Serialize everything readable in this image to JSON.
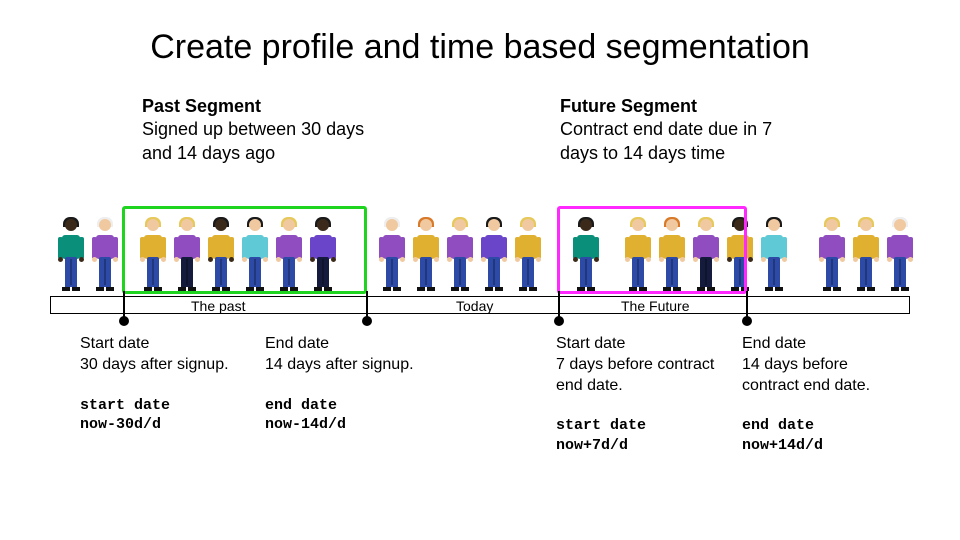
{
  "title": "Create profile and time based segmentation",
  "pastSegment": {
    "heading": "Past Segment",
    "desc": "Signed up between 30 days and 14 days ago"
  },
  "futureSegment": {
    "heading": "Future Segment",
    "desc": "Contract end date due in 7 days to 14 days time"
  },
  "timeline": {
    "past": "The past",
    "today": "Today",
    "future": "The Future"
  },
  "anno": {
    "pastStart": {
      "txt": "Start date\n30 days after signup.",
      "code": "start date\nnow-30d/d"
    },
    "pastEnd": {
      "txt": "End date\n14 days after signup.",
      "code": "end date\nnow-14d/d"
    },
    "futStart": {
      "txt": "Start date\n7 days before contract end date.",
      "code": "start date\nnow+7d/d"
    },
    "futEnd": {
      "txt": "End date\n14 days before contract end date.",
      "code": "end date\nnow+14d/d"
    }
  },
  "colors": {
    "pastBox": "#1fd41f",
    "futureBox": "#ff29ff",
    "pants": "#2d4aa6",
    "darkPants": "#141b3d"
  },
  "people": [
    {
      "skin": "#3b2a1a",
      "hair": "#1a1a1a",
      "shirt": "#0a8f7a",
      "pants": "#2d4aa6"
    },
    {
      "skin": "#f0c9a0",
      "hair": "#eee",
      "shirt": "#8f4dbf",
      "pants": "#2d4aa6"
    },
    {
      "skin": "#f0c9a0",
      "hair": "#e6c95a",
      "shirt": "#e0b030",
      "pants": "#2d4aa6"
    },
    {
      "skin": "#f0c9a0",
      "hair": "#e6c95a",
      "shirt": "#8f4dbf",
      "pants": "#141b3d"
    },
    {
      "skin": "#3b2a1a",
      "hair": "#1a1a1a",
      "shirt": "#e0b030",
      "pants": "#2d4aa6"
    },
    {
      "skin": "#f0c9a0",
      "hair": "#1a1a1a",
      "shirt": "#5fc9d6",
      "pants": "#2d4aa6"
    },
    {
      "skin": "#f0c9a0",
      "hair": "#e6c95a",
      "shirt": "#8f4dbf",
      "pants": "#2d4aa6"
    },
    {
      "skin": "#3b2a1a",
      "hair": "#1a1a1a",
      "shirt": "#6a45c9",
      "pants": "#141b3d"
    },
    {
      "skin": "#f0c9a0",
      "hair": "#eee",
      "shirt": "#8f4dbf",
      "pants": "#2d4aa6"
    },
    {
      "skin": "#f0c9a0",
      "hair": "#d97a2a",
      "shirt": "#e0b030",
      "pants": "#2d4aa6"
    },
    {
      "skin": "#f0c9a0",
      "hair": "#e6c95a",
      "shirt": "#8f4dbf",
      "pants": "#2d4aa6"
    },
    {
      "skin": "#f0c9a0",
      "hair": "#1a1a1a",
      "shirt": "#6a45c9",
      "pants": "#2d4aa6"
    },
    {
      "skin": "#f0c9a0",
      "hair": "#e6c95a",
      "shirt": "#e0b030",
      "pants": "#2d4aa6"
    },
    {
      "skin": "#3b2a1a",
      "hair": "#1a1a1a",
      "shirt": "#0a8f7a",
      "pants": "#2d4aa6"
    },
    {
      "skin": "#f0c9a0",
      "hair": "#e6c95a",
      "shirt": "#e0b030",
      "pants": "#2d4aa6"
    },
    {
      "skin": "#f0c9a0",
      "hair": "#d97a2a",
      "shirt": "#e0b030",
      "pants": "#2d4aa6"
    },
    {
      "skin": "#f0c9a0",
      "hair": "#e6c95a",
      "shirt": "#8f4dbf",
      "pants": "#141b3d"
    },
    {
      "skin": "#3b2a1a",
      "hair": "#1a1a1a",
      "shirt": "#e0b030",
      "pants": "#2d4aa6"
    },
    {
      "skin": "#f0c9a0",
      "hair": "#1a1a1a",
      "shirt": "#5fc9d6",
      "pants": "#2d4aa6"
    },
    {
      "skin": "#f0c9a0",
      "hair": "#e6c95a",
      "shirt": "#8f4dbf",
      "pants": "#2d4aa6"
    },
    {
      "skin": "#f0c9a0",
      "hair": "#e6c95a",
      "shirt": "#e0b030",
      "pants": "#2d4aa6"
    },
    {
      "skin": "#f0c9a0",
      "hair": "#eee",
      "shirt": "#8f4dbf",
      "pants": "#2d4aa6"
    }
  ]
}
